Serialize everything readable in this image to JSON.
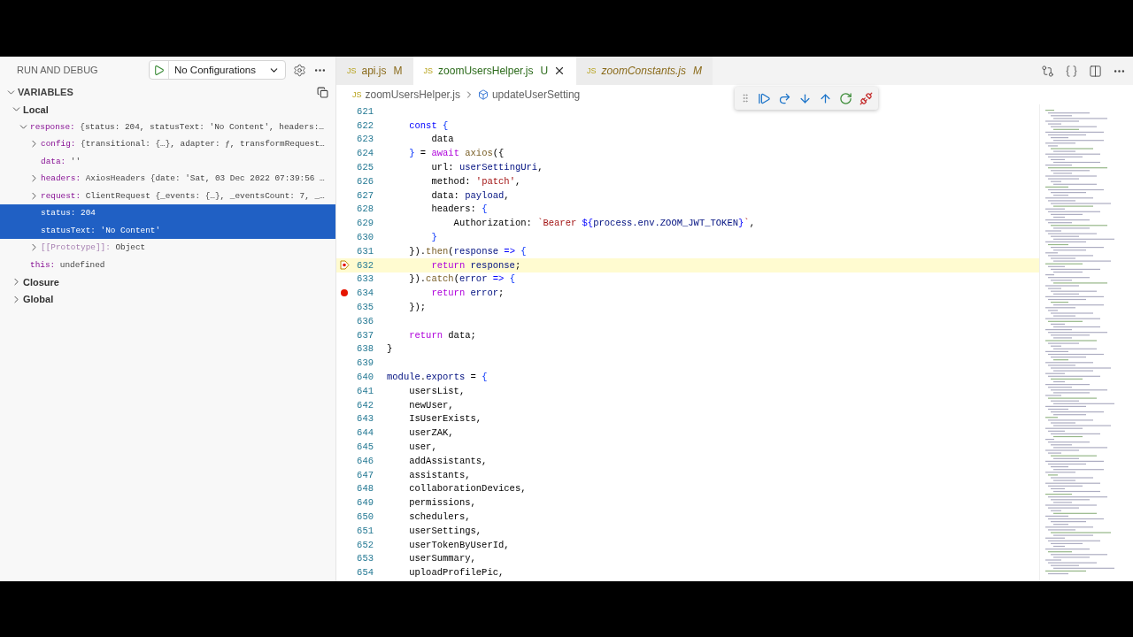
{
  "sidebar": {
    "title": "RUN AND DEBUG",
    "config": "No Configurations",
    "variables": {
      "title": "VARIABLES",
      "expanded": true,
      "items": [
        {
          "kind": "scope",
          "name": "Local",
          "expanded": true,
          "children": [
            {
              "kind": "var",
              "name": "response:",
              "value": "{status: 204, statusText: 'No Content', headers:…",
              "expanded": true,
              "selected": false,
              "children": [
                {
                  "kind": "var",
                  "name": "config:",
                  "value": "{transitional: {…}, adapter: ƒ, transformRequest…",
                  "expanded": false,
                  "selected": false
                },
                {
                  "kind": "var",
                  "name": "data:",
                  "value": "''",
                  "selected": false
                },
                {
                  "kind": "var",
                  "name": "headers:",
                  "value": "AxiosHeaders {date: 'Sat, 03 Dec 2022 07:39:56 …",
                  "expanded": false,
                  "selected": false
                },
                {
                  "kind": "var",
                  "name": "request:",
                  "value": "ClientRequest {_events: {…}, _eventsCount: 7, _…",
                  "expanded": false,
                  "selected": false
                },
                {
                  "kind": "var",
                  "name": "status:",
                  "value": "204",
                  "selected": true
                },
                {
                  "kind": "var",
                  "name": "statusText:",
                  "value": "'No Content'",
                  "selected": true
                },
                {
                  "kind": "internal",
                  "name": "[[Prototype]]:",
                  "value": "Object",
                  "expanded": false,
                  "selected": false
                }
              ]
            },
            {
              "kind": "var",
              "name": "this:",
              "value": "undefined",
              "selected": false
            }
          ]
        },
        {
          "kind": "scope",
          "name": "Closure",
          "expanded": false
        },
        {
          "kind": "scope",
          "name": "Global",
          "expanded": false
        }
      ]
    }
  },
  "tabs": [
    {
      "file_icon": "JS",
      "label": "api.js",
      "badge": "M",
      "selected": false,
      "italic": false
    },
    {
      "file_icon": "JS",
      "label": "zoomUsersHelper.js",
      "badge": "U",
      "selected": true,
      "italic": false
    },
    {
      "file_icon": "JS",
      "label": "zoomConstants.js",
      "badge": "M",
      "selected": false,
      "italic": true
    }
  ],
  "breadcrumb": {
    "file_icon": "JS",
    "file": "zoomUsersHelper.js",
    "symbol": "updateUserSetting"
  },
  "code": [
    {
      "number": "621",
      "breakpoint": false,
      "current": false
    },
    {
      "number": "622",
      "breakpoint": false,
      "current": false,
      "tokens": [
        {
          "kind": "decl",
          "text": "    const "
        },
        {
          "kind": "brace",
          "text": "{"
        }
      ]
    },
    {
      "number": "623",
      "breakpoint": false,
      "current": false,
      "tokens": [
        {
          "kind": "plain",
          "text": "        data"
        }
      ]
    },
    {
      "number": "624",
      "breakpoint": false,
      "current": false,
      "tokens": [
        {
          "kind": "brace",
          "text": "    }"
        },
        {
          "kind": "plain",
          "text": " = "
        },
        {
          "kind": "control",
          "text": "await "
        },
        {
          "kind": "func",
          "text": "axios"
        },
        {
          "kind": "plain",
          "text": "({"
        }
      ]
    },
    {
      "number": "625",
      "breakpoint": false,
      "current": false,
      "tokens": [
        {
          "kind": "plain",
          "text": "        url: "
        },
        {
          "kind": "var",
          "text": "userSettingUri"
        },
        {
          "kind": "plain",
          "text": ","
        }
      ]
    },
    {
      "number": "626",
      "breakpoint": false,
      "current": false,
      "tokens": [
        {
          "kind": "plain",
          "text": "        method: "
        },
        {
          "kind": "string",
          "text": "'patch'"
        },
        {
          "kind": "plain",
          "text": ","
        }
      ]
    },
    {
      "number": "627",
      "breakpoint": false,
      "current": false,
      "tokens": [
        {
          "kind": "plain",
          "text": "        data: "
        },
        {
          "kind": "var",
          "text": "payload"
        },
        {
          "kind": "plain",
          "text": ","
        }
      ]
    },
    {
      "number": "628",
      "breakpoint": false,
      "current": false,
      "tokens": [
        {
          "kind": "plain",
          "text": "        headers: "
        },
        {
          "kind": "brace",
          "text": "{"
        }
      ]
    },
    {
      "number": "629",
      "breakpoint": false,
      "current": false,
      "tokens": [
        {
          "kind": "plain",
          "text": "            Authorization: "
        },
        {
          "kind": "string",
          "text": "`Bearer "
        },
        {
          "kind": "decl",
          "text": "${"
        },
        {
          "kind": "var",
          "text": "process.env.ZOOM_JWT_TOKEN"
        },
        {
          "kind": "decl",
          "text": "}"
        },
        {
          "kind": "string",
          "text": "`"
        },
        {
          "kind": "plain",
          "text": ","
        }
      ]
    },
    {
      "number": "630",
      "breakpoint": false,
      "current": false,
      "tokens": [
        {
          "kind": "brace",
          "text": "        }"
        }
      ]
    },
    {
      "number": "631",
      "breakpoint": false,
      "current": false,
      "tokens": [
        {
          "kind": "plain",
          "text": "    })."
        },
        {
          "kind": "func",
          "text": "then"
        },
        {
          "kind": "plain",
          "text": "("
        },
        {
          "kind": "var",
          "text": "response "
        },
        {
          "kind": "decl",
          "text": "=> "
        },
        {
          "kind": "brace",
          "text": "{"
        }
      ]
    },
    {
      "number": "632",
      "breakpoint": true,
      "current": true,
      "tokens": [
        {
          "kind": "control",
          "text": "        return "
        },
        {
          "kind": "var",
          "text": "response"
        },
        {
          "kind": "plain",
          "text": ";"
        }
      ]
    },
    {
      "number": "633",
      "breakpoint": false,
      "current": false,
      "tokens": [
        {
          "kind": "plain",
          "text": "    })."
        },
        {
          "kind": "func",
          "text": "catch"
        },
        {
          "kind": "plain",
          "text": "("
        },
        {
          "kind": "var",
          "text": "error "
        },
        {
          "kind": "decl",
          "text": "=> "
        },
        {
          "kind": "brace",
          "text": "{"
        }
      ]
    },
    {
      "number": "634",
      "breakpoint": true,
      "current": false,
      "tokens": [
        {
          "kind": "control",
          "text": "        return "
        },
        {
          "kind": "var",
          "text": "error"
        },
        {
          "kind": "plain",
          "text": ";"
        }
      ]
    },
    {
      "number": "635",
      "breakpoint": false,
      "current": false,
      "tokens": [
        {
          "kind": "plain",
          "text": "    });"
        }
      ]
    },
    {
      "number": "636",
      "breakpoint": false,
      "current": false
    },
    {
      "number": "637",
      "breakpoint": false,
      "current": false,
      "tokens": [
        {
          "kind": "control",
          "text": "    return "
        },
        {
          "kind": "plain",
          "text": "data;"
        }
      ]
    },
    {
      "number": "638",
      "breakpoint": false,
      "current": false,
      "tokens": [
        {
          "kind": "plain",
          "text": "}"
        }
      ]
    },
    {
      "number": "639",
      "breakpoint": false,
      "current": false
    },
    {
      "number": "640",
      "breakpoint": false,
      "current": false,
      "tokens": [
        {
          "kind": "var",
          "text": "module"
        },
        {
          "kind": "plain",
          "text": "."
        },
        {
          "kind": "var",
          "text": "exports"
        },
        {
          "kind": "plain",
          "text": " = "
        },
        {
          "kind": "brace",
          "text": "{"
        }
      ]
    },
    {
      "number": "641",
      "breakpoint": false,
      "current": false,
      "tokens": [
        {
          "kind": "plain",
          "text": "    usersList,"
        }
      ]
    },
    {
      "number": "642",
      "breakpoint": false,
      "current": false,
      "tokens": [
        {
          "kind": "plain",
          "text": "    newUser,"
        }
      ]
    },
    {
      "number": "643",
      "breakpoint": false,
      "current": false,
      "tokens": [
        {
          "kind": "plain",
          "text": "    IsUserExists,"
        }
      ]
    },
    {
      "number": "644",
      "breakpoint": false,
      "current": false,
      "tokens": [
        {
          "kind": "plain",
          "text": "    userZAK,"
        }
      ]
    },
    {
      "number": "645",
      "breakpoint": false,
      "current": false,
      "tokens": [
        {
          "kind": "plain",
          "text": "    user,"
        }
      ]
    },
    {
      "number": "646",
      "breakpoint": false,
      "current": false,
      "tokens": [
        {
          "kind": "plain",
          "text": "    addAssistants,"
        }
      ]
    },
    {
      "number": "647",
      "breakpoint": false,
      "current": false,
      "tokens": [
        {
          "kind": "plain",
          "text": "    assistants,"
        }
      ]
    },
    {
      "number": "648",
      "breakpoint": false,
      "current": false,
      "tokens": [
        {
          "kind": "plain",
          "text": "    collaborationDevices,"
        }
      ]
    },
    {
      "number": "649",
      "breakpoint": false,
      "current": false,
      "tokens": [
        {
          "kind": "plain",
          "text": "    permissions,"
        }
      ]
    },
    {
      "number": "650",
      "breakpoint": false,
      "current": false,
      "tokens": [
        {
          "kind": "plain",
          "text": "    schedulers,"
        }
      ]
    },
    {
      "number": "651",
      "breakpoint": false,
      "current": false,
      "tokens": [
        {
          "kind": "plain",
          "text": "    userSettings,"
        }
      ]
    },
    {
      "number": "652",
      "breakpoint": false,
      "current": false,
      "tokens": [
        {
          "kind": "plain",
          "text": "    userTokenByUserId,"
        }
      ]
    },
    {
      "number": "653",
      "breakpoint": false,
      "current": false,
      "tokens": [
        {
          "kind": "plain",
          "text": "    userSummary,"
        }
      ]
    },
    {
      "number": "654",
      "breakpoint": false,
      "current": false,
      "tokens": [
        {
          "kind": "plain",
          "text": "    uploadProfilePic,"
        }
      ]
    }
  ]
}
